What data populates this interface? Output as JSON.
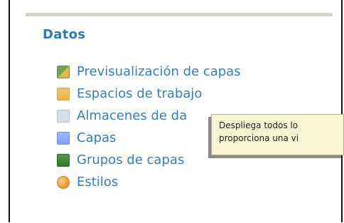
{
  "section": {
    "title": "Datos"
  },
  "menu": {
    "items": [
      {
        "label": "Previsualización de capas",
        "icon": "map-preview-icon"
      },
      {
        "label": "Espacios de trabajo",
        "icon": "folder-workspaces-icon"
      },
      {
        "label": "Almacenes de da",
        "icon": "datastore-icon"
      },
      {
        "label": "Capas",
        "icon": "layers-icon"
      },
      {
        "label": "Grupos de capas",
        "icon": "layer-groups-icon"
      },
      {
        "label": "Estilos",
        "icon": "styles-icon"
      }
    ]
  },
  "tooltip": {
    "line1": "Despliega todos lo",
    "line2": "proporciona una vi"
  },
  "colors": {
    "link": "#2f7fc6",
    "section_title": "#2a78c0",
    "tooltip_bg": "#fbf6d2"
  }
}
